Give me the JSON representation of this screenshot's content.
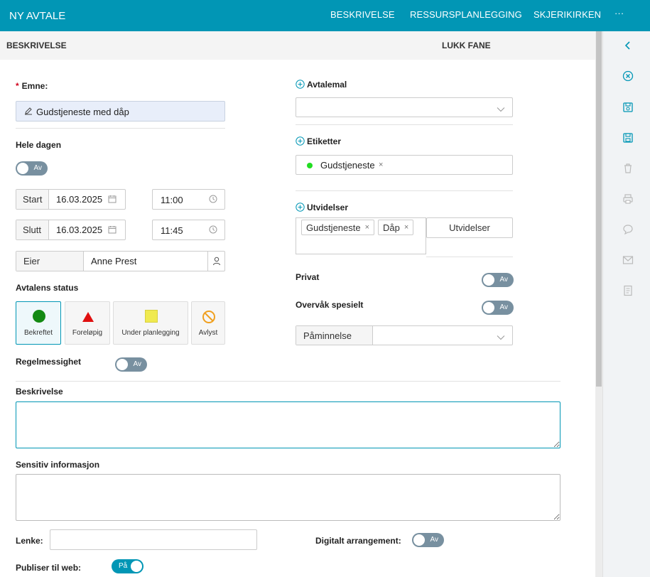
{
  "header": {
    "title": "NY AVTALE",
    "nav": [
      "BESKRIVELSE",
      "RESSURSPLANLEGGING",
      "SKJERIKIRKEN",
      "···"
    ]
  },
  "subbar": {
    "tab": "BESKRIVELSE",
    "close": "LUKK FANE"
  },
  "form": {
    "emne_label": "Emne:",
    "emne_value": "Gudstjeneste med dåp",
    "hele_dagen_label": "Hele dagen",
    "hele_dagen_toggle": "Av",
    "start_label": "Start",
    "start_date": "16.03.2025",
    "start_time": "11:00",
    "slutt_label": "Slutt",
    "slutt_date": "16.03.2025",
    "slutt_time": "11:45",
    "eier_label": "Eier",
    "eier_value": "Anne Prest",
    "status_label": "Avtalens status",
    "statuses": [
      {
        "label": "Bekreftet",
        "color": "#138a13"
      },
      {
        "label": "Foreløpig",
        "color": "#e01010"
      },
      {
        "label": "Under planlegging",
        "color": "#f0ea50"
      },
      {
        "label": "Avlyst",
        "color": "#f0a020"
      }
    ],
    "regelmessighet_label": "Regelmessighet",
    "regelmessighet_toggle": "Av",
    "beskrivelse_label": "Beskrivelse",
    "sensitiv_label": "Sensitiv informasjon",
    "lenke_label": "Lenke:",
    "digitalt_label": "Digitalt arrangement:",
    "digitalt_toggle": "Av",
    "publiser_label": "Publiser til web:",
    "publiser_toggle": "På"
  },
  "right": {
    "avtalemal_label": "Avtalemal",
    "etiketter_label": "Etiketter",
    "etikett_chip": "Gudstjeneste",
    "etikett_color": "#22dd22",
    "utvidelser_label": "Utvidelser",
    "utvidelser_chips": [
      "Gudstjeneste",
      "Dåp"
    ],
    "utvidelser_button": "Utvidelser",
    "privat_label": "Privat",
    "privat_toggle": "Av",
    "overvak_label": "Overvåk spesielt",
    "overvak_toggle": "Av",
    "paminnelse_label": "Påminnelse"
  },
  "sidebar_icons": [
    "back-icon",
    "close-circle-icon",
    "save-settings-icon",
    "save-icon",
    "trash-icon",
    "print-icon",
    "comment-icon",
    "mail-icon",
    "document-icon"
  ],
  "accent": "#0196b5"
}
